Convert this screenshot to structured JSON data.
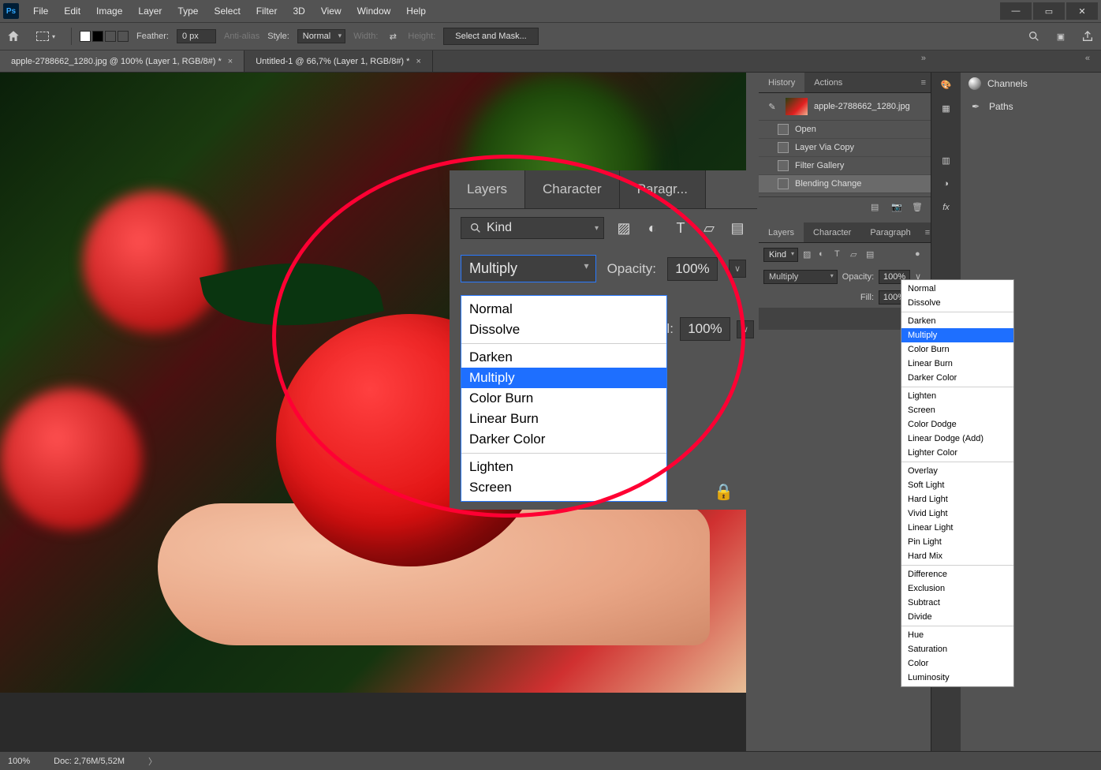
{
  "menu": [
    "File",
    "Edit",
    "Image",
    "Layer",
    "Type",
    "Select",
    "Filter",
    "3D",
    "View",
    "Window",
    "Help"
  ],
  "options": {
    "feather_label": "Feather:",
    "feather_value": "0 px",
    "anti_alias": "Anti-alias",
    "style_label": "Style:",
    "style_value": "Normal",
    "width_label": "Width:",
    "height_label": "Height:",
    "select_mask": "Select and Mask..."
  },
  "tabs": [
    "apple-2788662_1280.jpg @ 100% (Layer 1, RGB/8#) *",
    "Untitled-1 @ 66,7% (Layer 1, RGB/8#) *"
  ],
  "zoom_panel": {
    "tabs": [
      "Layers",
      "Character",
      "Paragr..."
    ],
    "kind": "Kind",
    "blend": "Multiply",
    "opacity_label": "Opacity:",
    "opacity_value": "100%",
    "fill_label": "Fill:",
    "fill_value": "100%",
    "options_g1": [
      "Normal",
      "Dissolve"
    ],
    "options_g2": [
      "Darken",
      "Multiply",
      "Color Burn",
      "Linear Burn",
      "Darker Color"
    ],
    "options_g3": [
      "Lighten",
      "Screen"
    ]
  },
  "history": {
    "tab_history": "History",
    "tab_actions": "Actions",
    "doc": "apple-2788662_1280.jpg",
    "items": [
      "Open",
      "Layer Via Copy",
      "Filter Gallery",
      "Blending Change"
    ]
  },
  "layers": {
    "tabs": [
      "Layers",
      "Character",
      "Paragraph"
    ],
    "kind": "Kind",
    "blend": "Multiply",
    "opacity_label": "Opacity:",
    "opacity_value": "100%",
    "fill_label": "Fill:",
    "fill_value": "100%",
    "modes_g1": [
      "Normal",
      "Dissolve"
    ],
    "modes_g2": [
      "Darken",
      "Multiply",
      "Color Burn",
      "Linear Burn",
      "Darker Color"
    ],
    "modes_g3": [
      "Lighten",
      "Screen",
      "Color Dodge",
      "Linear Dodge (Add)",
      "Lighter Color"
    ],
    "modes_g4": [
      "Overlay",
      "Soft Light",
      "Hard Light",
      "Vivid Light",
      "Linear Light",
      "Pin Light",
      "Hard Mix"
    ],
    "modes_g5": [
      "Difference",
      "Exclusion",
      "Subtract",
      "Divide"
    ],
    "modes_g6": [
      "Hue",
      "Saturation",
      "Color",
      "Luminosity"
    ]
  },
  "extras": {
    "channels": "Channels",
    "paths": "Paths"
  },
  "status": {
    "zoom": "100%",
    "doc": "Doc: 2,76M/5,52M"
  }
}
